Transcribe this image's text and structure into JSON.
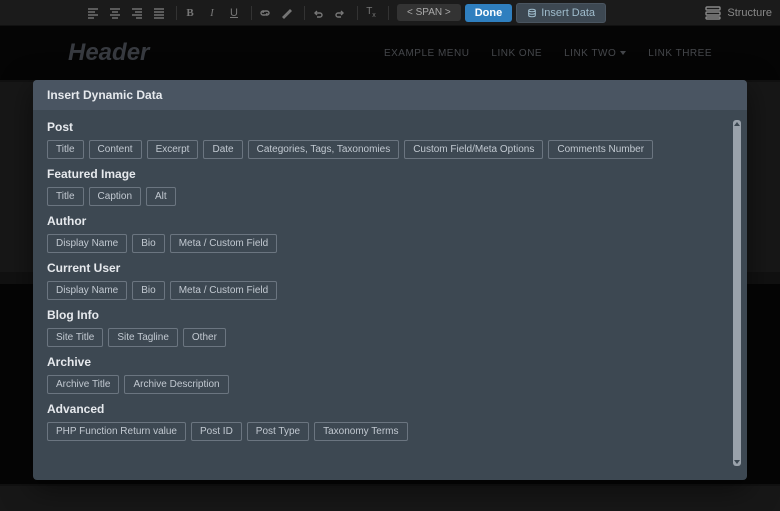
{
  "toolbar": {
    "span_label": "< SPAN >",
    "done_label": "Done",
    "insert_label": "Insert Data",
    "structure_label": "Structure"
  },
  "header": {
    "title": "Header",
    "nav": [
      "EXAMPLE MENU",
      "LINK ONE",
      "LINK TWO",
      "LINK THREE"
    ]
  },
  "modal": {
    "title": "Insert Dynamic Data",
    "sections": [
      {
        "title": "Post",
        "options": [
          "Title",
          "Content",
          "Excerpt",
          "Date",
          "Categories, Tags, Taxonomies",
          "Custom Field/Meta Options",
          "Comments Number"
        ]
      },
      {
        "title": "Featured Image",
        "options": [
          "Title",
          "Caption",
          "Alt"
        ]
      },
      {
        "title": "Author",
        "options": [
          "Display Name",
          "Bio",
          "Meta / Custom Field"
        ]
      },
      {
        "title": "Current User",
        "options": [
          "Display Name",
          "Bio",
          "Meta / Custom Field"
        ]
      },
      {
        "title": "Blog Info",
        "options": [
          "Site Title",
          "Site Tagline",
          "Other"
        ]
      },
      {
        "title": "Archive",
        "options": [
          "Archive Title",
          "Archive Description"
        ]
      },
      {
        "title": "Advanced",
        "options": [
          "PHP Function Return value",
          "Post ID",
          "Post Type",
          "Taxonomy Terms"
        ]
      }
    ]
  }
}
